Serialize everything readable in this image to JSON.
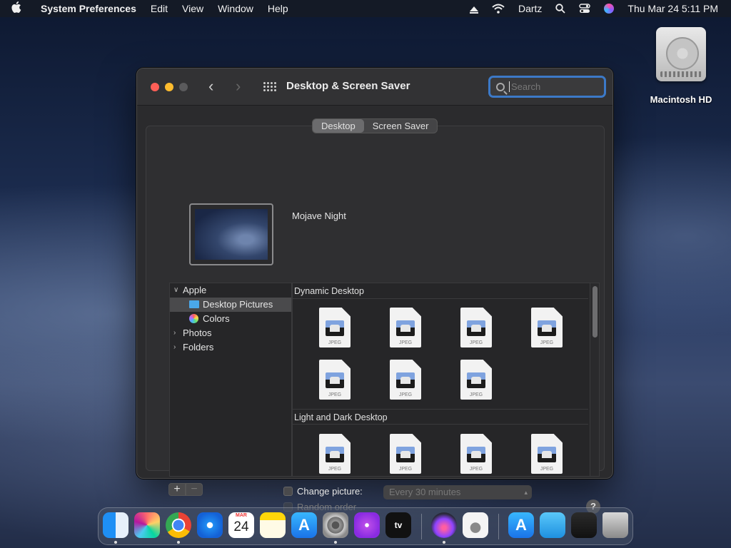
{
  "menubar": {
    "apple_icon": "apple-logo-icon",
    "app_name": "System Preferences",
    "menus": [
      "Edit",
      "View",
      "Window",
      "Help"
    ],
    "user": "Dartz",
    "datetime": "Thu Mar 24  5:11 PM"
  },
  "desktop": {
    "disk_label": "Macintosh HD"
  },
  "window": {
    "title": "Desktop & Screen Saver",
    "search_placeholder": "Search",
    "tabs": [
      {
        "label": "Desktop",
        "selected": true
      },
      {
        "label": "Screen Saver",
        "selected": false
      }
    ],
    "current_wallpaper": "Mojave Night",
    "sidebar": {
      "apple": "Apple",
      "desktop_pictures": "Desktop Pictures",
      "colors": "Colors",
      "photos": "Photos",
      "folders": "Folders"
    },
    "sections": [
      {
        "title": "Dynamic Desktop",
        "count": 7
      },
      {
        "title": "Light and Dark Desktop",
        "count": 4
      }
    ],
    "file_tag": "JPEG",
    "change_picture_label": "Change picture:",
    "interval": "Every 30 minutes",
    "random_order_label": "Random order",
    "help": "?"
  },
  "dock": {
    "calendar_month": "MAR",
    "calendar_day": "24",
    "tv_label": "tv",
    "apps": [
      "Finder",
      "Launchpad",
      "Google Chrome",
      "Safari",
      "Calendar",
      "Notes",
      "App Store",
      "System Preferences",
      "Podcasts",
      "TV",
      "Installer",
      "Disk Utility",
      "App Store",
      "Downloads",
      "Utilities",
      "Trash"
    ]
  },
  "colors": {
    "accent": "#3c79c7",
    "close": "#ff5f57",
    "minimize": "#febc2e",
    "window_bg": "#2b2b2d"
  }
}
